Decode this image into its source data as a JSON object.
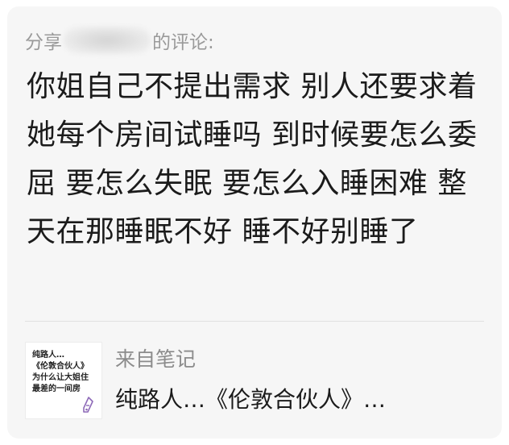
{
  "share_header": {
    "prefix": "分享",
    "suffix": "的评论:"
  },
  "comment": {
    "text": "你姐自己不提出需求 别人还要求着她每个房间试睡吗 到时候要怎么委屈 要怎么失眠 要怎么入睡困难 整天在那睡眠不好 睡不好别睡了"
  },
  "source_note": {
    "label": "来自笔记",
    "title": "纯路人…《伦敦合伙人》…",
    "thumbnail_lines": [
      "纯路人…",
      "《伦敦合伙人》",
      "为什么让大姐住",
      "最差的一间房"
    ]
  },
  "colors": {
    "card_background": "#f6f6f6",
    "secondary_text": "#9a9a9a",
    "primary_text": "#1b1b1b",
    "thumb_icon_accent": "#8e6ab8"
  }
}
